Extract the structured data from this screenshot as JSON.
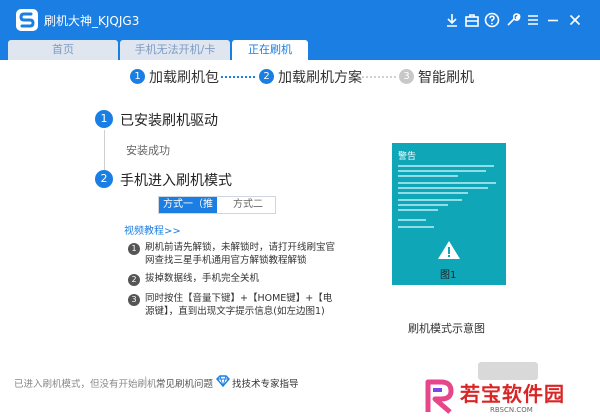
{
  "window": {
    "title": "刷机大神_KJQJG3"
  },
  "tabs": [
    {
      "label": "首页"
    },
    {
      "label": "手机无法开机/卡"
    },
    {
      "label": "正在刷机"
    }
  ],
  "steps": [
    {
      "number": "1",
      "label": "加载刷机包"
    },
    {
      "number": "2",
      "label": "加载刷机方案"
    },
    {
      "number": "3",
      "label": "智能刷机"
    }
  ],
  "substep1": {
    "number": "1",
    "title": "已安装刷机驱动",
    "status": "安装成功"
  },
  "substep2": {
    "number": "2",
    "title": "手机进入刷机模式"
  },
  "method_tabs": [
    {
      "label": "方式一（推荐）"
    },
    {
      "label": "方式二"
    }
  ],
  "video_link": "视频教程>>",
  "instructions": [
    {
      "number": "1",
      "text": "刷机前请先解锁，未解锁时，请打开线刷宝官网查找三星手机通用官方解锁教程解锁"
    },
    {
      "number": "2",
      "text": "拔掉数据线，手机完全关机"
    },
    {
      "number": "3",
      "text": "同时按住【音量下键】+【HOME键】+【电源键】，直到出现文字提示信息(如左边图1)"
    }
  ],
  "phone_image": {
    "heading": "警告",
    "figure_label": "图1"
  },
  "phone_caption": "刷机模式示意图",
  "footer": {
    "status": "已进入刷机模式，但没有开始刷机",
    "separator": "|",
    "faq": "常见刷机问题",
    "support": "找技术专家指导"
  },
  "watermark": {
    "title": "若宝软件园",
    "url": "RBSCN.COM"
  },
  "colors": {
    "accent": "#1a7ee2",
    "phone_bg": "#0fa6b8",
    "watermark": "#d92525"
  }
}
